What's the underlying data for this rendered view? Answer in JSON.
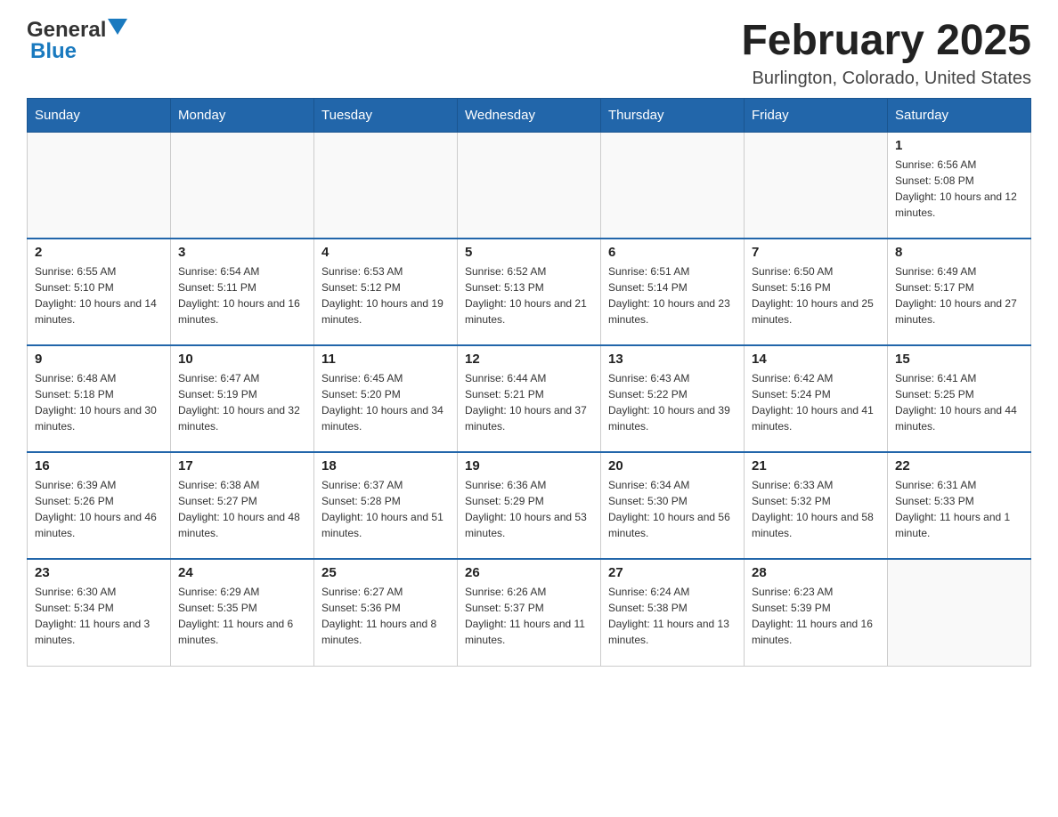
{
  "header": {
    "logo": {
      "general": "General",
      "blue": "Blue"
    },
    "title": "February 2025",
    "subtitle": "Burlington, Colorado, United States"
  },
  "weekdays": [
    "Sunday",
    "Monday",
    "Tuesday",
    "Wednesday",
    "Thursday",
    "Friday",
    "Saturday"
  ],
  "weeks": [
    [
      {
        "day": "",
        "info": ""
      },
      {
        "day": "",
        "info": ""
      },
      {
        "day": "",
        "info": ""
      },
      {
        "day": "",
        "info": ""
      },
      {
        "day": "",
        "info": ""
      },
      {
        "day": "",
        "info": ""
      },
      {
        "day": "1",
        "info": "Sunrise: 6:56 AM\nSunset: 5:08 PM\nDaylight: 10 hours and 12 minutes."
      }
    ],
    [
      {
        "day": "2",
        "info": "Sunrise: 6:55 AM\nSunset: 5:10 PM\nDaylight: 10 hours and 14 minutes."
      },
      {
        "day": "3",
        "info": "Sunrise: 6:54 AM\nSunset: 5:11 PM\nDaylight: 10 hours and 16 minutes."
      },
      {
        "day": "4",
        "info": "Sunrise: 6:53 AM\nSunset: 5:12 PM\nDaylight: 10 hours and 19 minutes."
      },
      {
        "day": "5",
        "info": "Sunrise: 6:52 AM\nSunset: 5:13 PM\nDaylight: 10 hours and 21 minutes."
      },
      {
        "day": "6",
        "info": "Sunrise: 6:51 AM\nSunset: 5:14 PM\nDaylight: 10 hours and 23 minutes."
      },
      {
        "day": "7",
        "info": "Sunrise: 6:50 AM\nSunset: 5:16 PM\nDaylight: 10 hours and 25 minutes."
      },
      {
        "day": "8",
        "info": "Sunrise: 6:49 AM\nSunset: 5:17 PM\nDaylight: 10 hours and 27 minutes."
      }
    ],
    [
      {
        "day": "9",
        "info": "Sunrise: 6:48 AM\nSunset: 5:18 PM\nDaylight: 10 hours and 30 minutes."
      },
      {
        "day": "10",
        "info": "Sunrise: 6:47 AM\nSunset: 5:19 PM\nDaylight: 10 hours and 32 minutes."
      },
      {
        "day": "11",
        "info": "Sunrise: 6:45 AM\nSunset: 5:20 PM\nDaylight: 10 hours and 34 minutes."
      },
      {
        "day": "12",
        "info": "Sunrise: 6:44 AM\nSunset: 5:21 PM\nDaylight: 10 hours and 37 minutes."
      },
      {
        "day": "13",
        "info": "Sunrise: 6:43 AM\nSunset: 5:22 PM\nDaylight: 10 hours and 39 minutes."
      },
      {
        "day": "14",
        "info": "Sunrise: 6:42 AM\nSunset: 5:24 PM\nDaylight: 10 hours and 41 minutes."
      },
      {
        "day": "15",
        "info": "Sunrise: 6:41 AM\nSunset: 5:25 PM\nDaylight: 10 hours and 44 minutes."
      }
    ],
    [
      {
        "day": "16",
        "info": "Sunrise: 6:39 AM\nSunset: 5:26 PM\nDaylight: 10 hours and 46 minutes."
      },
      {
        "day": "17",
        "info": "Sunrise: 6:38 AM\nSunset: 5:27 PM\nDaylight: 10 hours and 48 minutes."
      },
      {
        "day": "18",
        "info": "Sunrise: 6:37 AM\nSunset: 5:28 PM\nDaylight: 10 hours and 51 minutes."
      },
      {
        "day": "19",
        "info": "Sunrise: 6:36 AM\nSunset: 5:29 PM\nDaylight: 10 hours and 53 minutes."
      },
      {
        "day": "20",
        "info": "Sunrise: 6:34 AM\nSunset: 5:30 PM\nDaylight: 10 hours and 56 minutes."
      },
      {
        "day": "21",
        "info": "Sunrise: 6:33 AM\nSunset: 5:32 PM\nDaylight: 10 hours and 58 minutes."
      },
      {
        "day": "22",
        "info": "Sunrise: 6:31 AM\nSunset: 5:33 PM\nDaylight: 11 hours and 1 minute."
      }
    ],
    [
      {
        "day": "23",
        "info": "Sunrise: 6:30 AM\nSunset: 5:34 PM\nDaylight: 11 hours and 3 minutes."
      },
      {
        "day": "24",
        "info": "Sunrise: 6:29 AM\nSunset: 5:35 PM\nDaylight: 11 hours and 6 minutes."
      },
      {
        "day": "25",
        "info": "Sunrise: 6:27 AM\nSunset: 5:36 PM\nDaylight: 11 hours and 8 minutes."
      },
      {
        "day": "26",
        "info": "Sunrise: 6:26 AM\nSunset: 5:37 PM\nDaylight: 11 hours and 11 minutes."
      },
      {
        "day": "27",
        "info": "Sunrise: 6:24 AM\nSunset: 5:38 PM\nDaylight: 11 hours and 13 minutes."
      },
      {
        "day": "28",
        "info": "Sunrise: 6:23 AM\nSunset: 5:39 PM\nDaylight: 11 hours and 16 minutes."
      },
      {
        "day": "",
        "info": ""
      }
    ]
  ]
}
